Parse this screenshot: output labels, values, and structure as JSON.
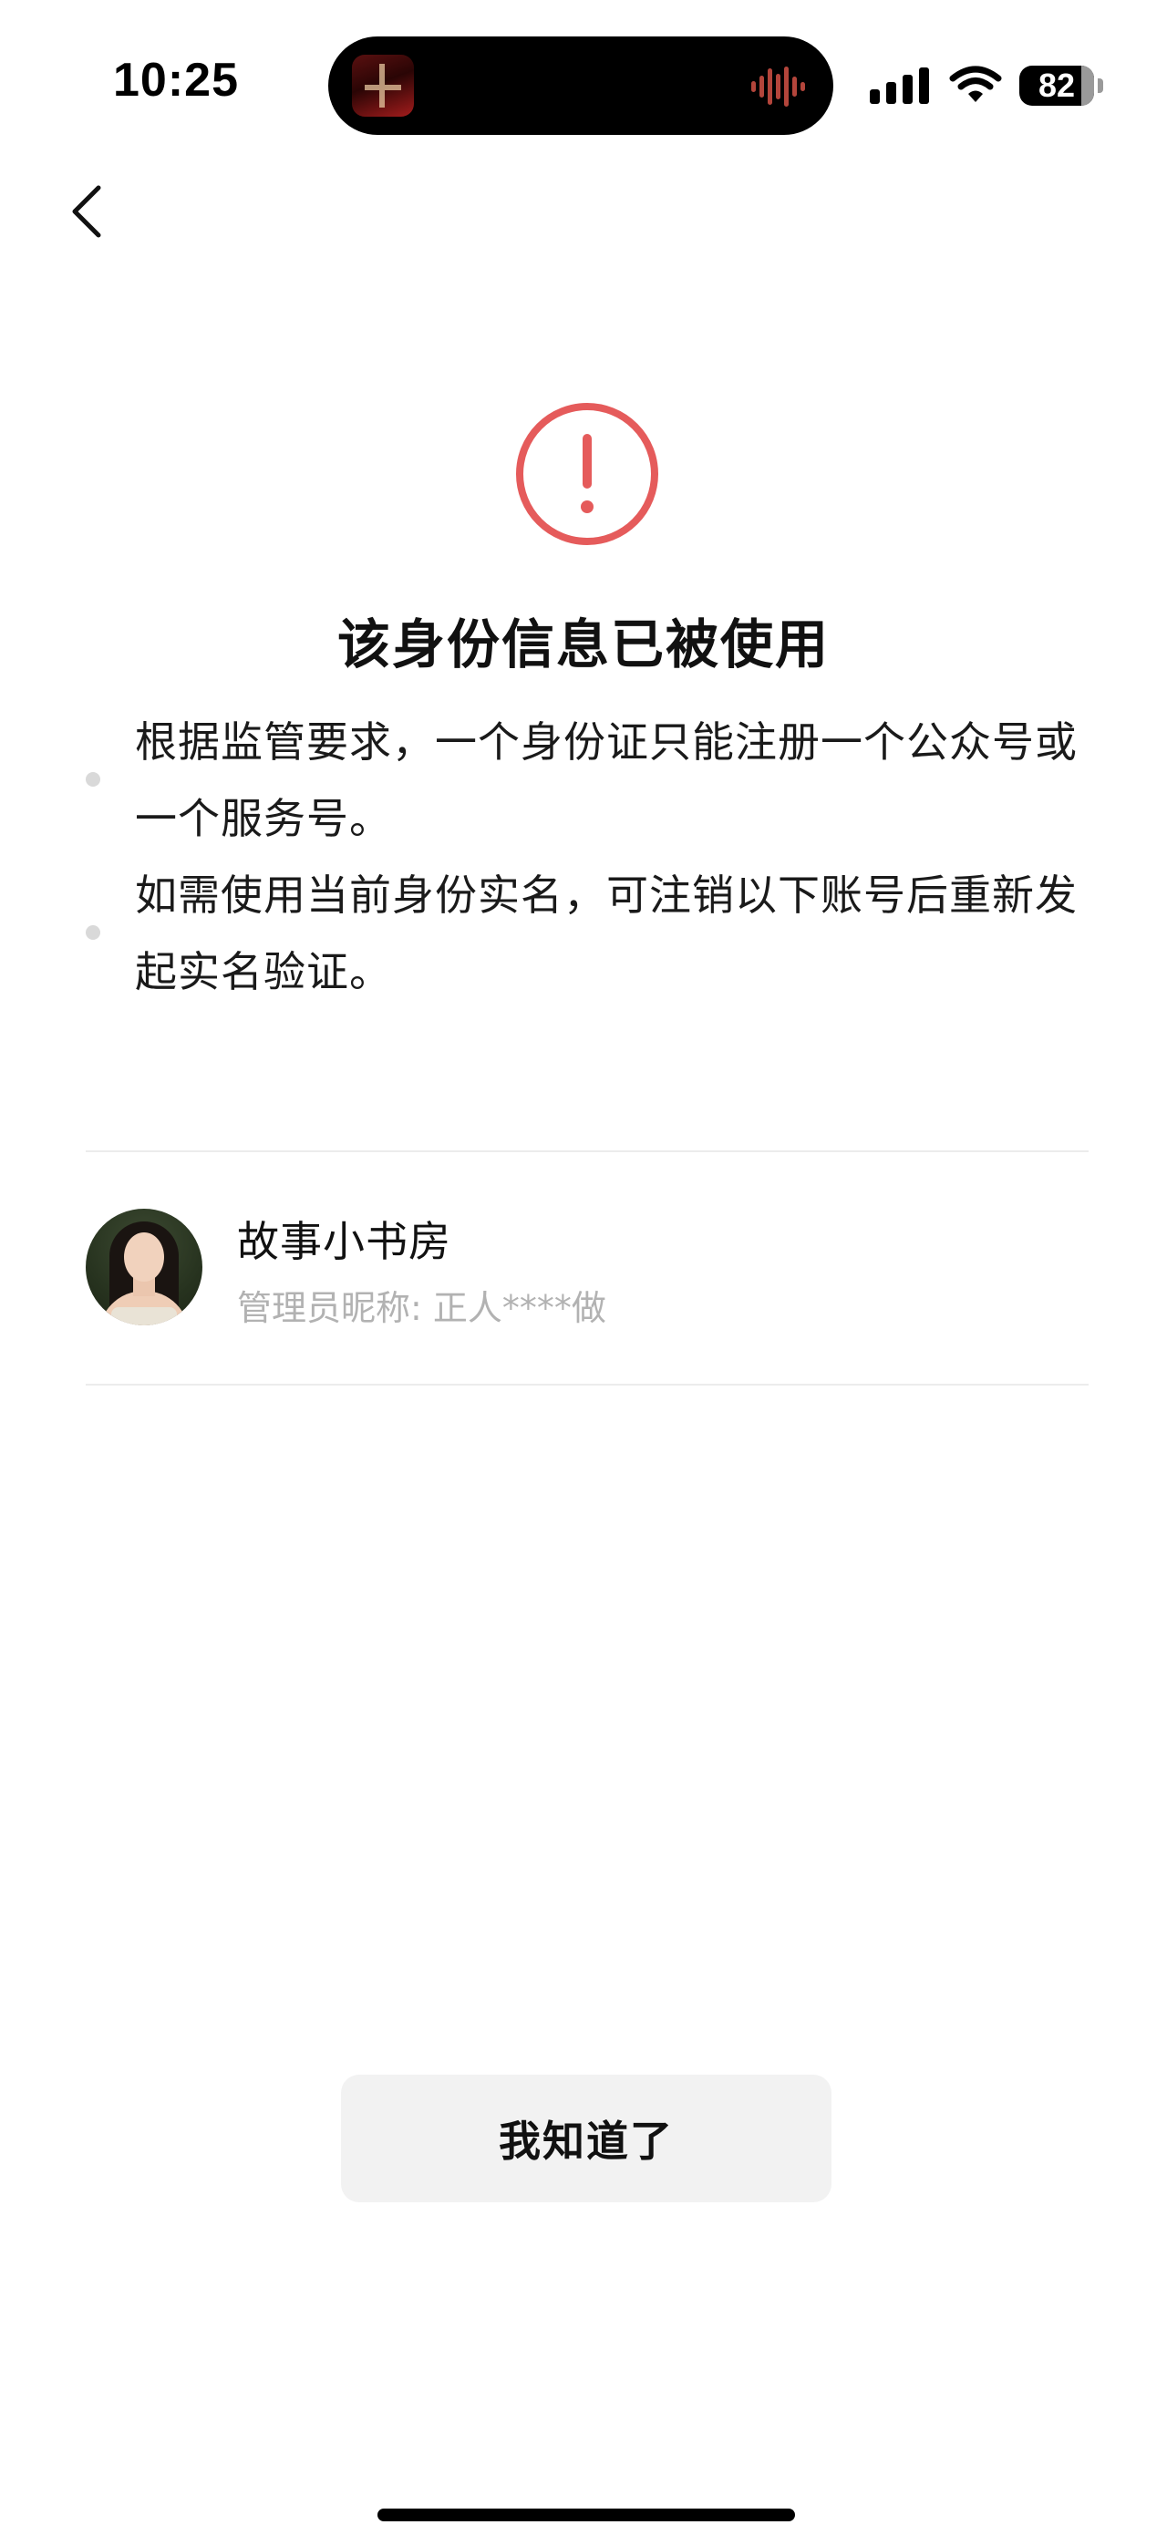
{
  "status_bar": {
    "time": "10:25",
    "battery_level": "82",
    "icons": [
      "app-icon",
      "voice-waveform-icon",
      "cellular-signal-icon",
      "wifi-icon",
      "battery-icon"
    ]
  },
  "nav": {
    "back_icon": "chevron-left-icon"
  },
  "warning": {
    "icon": "exclamation-circle-icon",
    "color": "#E55B5B"
  },
  "title": "该身份信息已被使用",
  "notes": [
    {
      "text": "根据监管要求，一个身份证只能注册一个公众号或一个服务号。"
    },
    {
      "text": "如需使用当前身份实名，可注销以下账号后重新发起实名验证。"
    }
  ],
  "account": {
    "name": "故事小书房",
    "admin_label": "管理员昵称: 正人****做",
    "avatar": "avatar-photo"
  },
  "actions": {
    "confirm_label": "我知道了"
  }
}
